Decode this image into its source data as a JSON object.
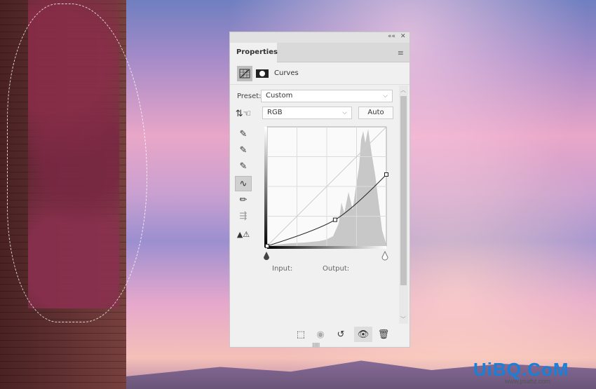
{
  "panel": {
    "collapse": "««",
    "close": "✕",
    "tab": "Properties",
    "adjustment": "Curves",
    "preset_label": "Preset:",
    "preset_value": "Custom",
    "channel_value": "RGB",
    "auto_label": "Auto",
    "input_label": "Input:",
    "output_label": "Output:",
    "curve_points": [
      [
        0,
        0
      ],
      [
        0.57,
        0.22
      ],
      [
        1,
        0.6
      ]
    ],
    "tools": [
      "white-point-eyedropper",
      "gray-point-eyedropper",
      "black-point-eyedropper",
      "edit-points",
      "pencil",
      "smooth",
      "clipping-warning"
    ],
    "bottom_tools": [
      "clip-to-layer",
      "view-previous",
      "reset",
      "toggle-visibility",
      "delete"
    ]
  },
  "watermark": {
    "logo": "UiBQ.CoM",
    "url": "www.psahz.com"
  }
}
